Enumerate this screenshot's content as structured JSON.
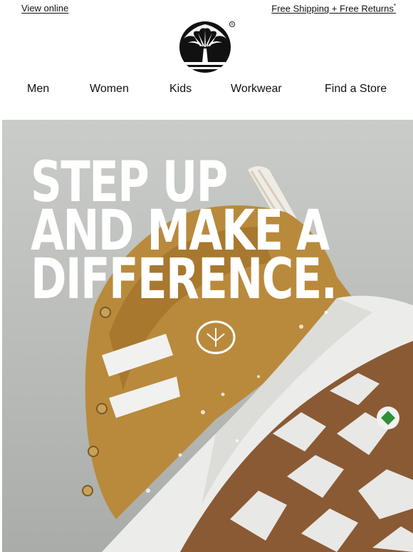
{
  "header": {
    "view_online": "View online",
    "shipping": "Free Shipping + Free Returns",
    "shipping_mark": "*"
  },
  "brand": {
    "logo_icon": "tree-logo-icon",
    "registered": "®"
  },
  "nav": {
    "items": [
      "Men",
      "Women",
      "Kids",
      "Workwear",
      "Find a Store"
    ]
  },
  "hero": {
    "headline": [
      "STEP UP",
      "AND MAKE A",
      "DIFFERENCE."
    ],
    "image": "boot-with-gum-sole-image",
    "colors": {
      "background": "#bfc2be",
      "wheat_leather": "#b98a3c",
      "gum_sole": "#8a5a34",
      "white_midsole": "#eeeeee",
      "green_badge": "#2f8f3a"
    }
  }
}
